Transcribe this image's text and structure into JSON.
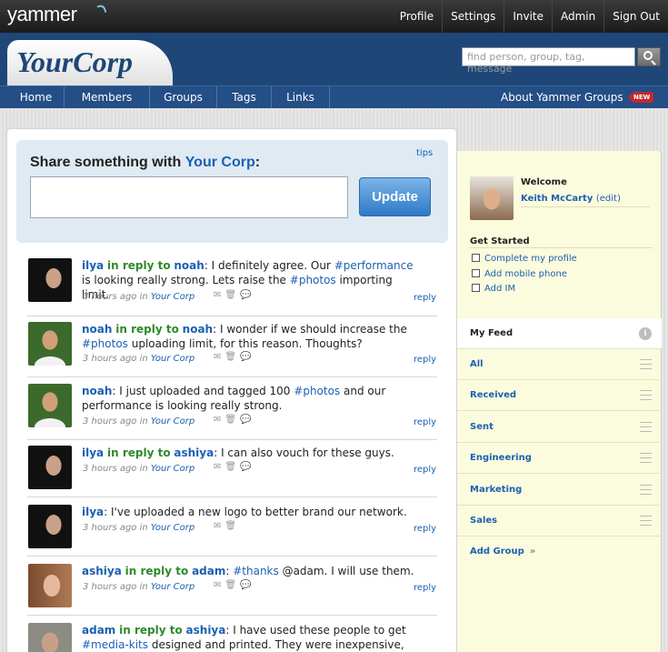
{
  "app": {
    "logo": "yammer",
    "company": "YourCorp"
  },
  "topnav": {
    "items": [
      "Profile",
      "Settings",
      "Invite",
      "Admin",
      "Sign Out"
    ]
  },
  "search": {
    "placeholder": "find person, group, tag, message",
    "icon": "search-icon"
  },
  "mainnav": {
    "items": [
      "Home",
      "Members",
      "Groups",
      "Tags",
      "Links"
    ],
    "about": "About Yammer Groups",
    "badge": "NEW"
  },
  "share": {
    "prefix": "Share something with ",
    "target": "Your Corp",
    "suffix": ":",
    "tips": "tips",
    "button": "Update",
    "value": ""
  },
  "messages": [
    {
      "user": "ilya",
      "reply_label": "in reply to",
      "reply_to": "noah",
      "parts": [
        ": I definitely agree. Our ",
        "#performance",
        " is looking really strong. Lets raise the ",
        "#photos",
        " importing limit."
      ],
      "time": "3 hours ago in",
      "group": "Your Corp",
      "reply": "reply",
      "avatar": "ilya"
    },
    {
      "user": "noah",
      "reply_label": "in reply to",
      "reply_to": "noah",
      "parts": [
        ": I wonder if we should increase the ",
        "#photos",
        " uploading limit, for this reason. Thoughts?"
      ],
      "time": "3 hours ago in",
      "group": "Your Corp",
      "reply": "reply",
      "avatar": "noah"
    },
    {
      "user": "noah",
      "parts": [
        ":  I just uploaded and tagged 100 ",
        "#photos",
        " and our performance is looking really strong."
      ],
      "time": "3 hours ago in",
      "group": "Your Corp",
      "reply": "reply",
      "avatar": "noah"
    },
    {
      "user": "ilya",
      "reply_label": "in reply to",
      "reply_to": "ashiya",
      "parts": [
        ": I can also vouch for these guys."
      ],
      "time": "3 hours ago in",
      "group": "Your Corp",
      "reply": "reply",
      "avatar": "ilya"
    },
    {
      "user": "ilya",
      "parts": [
        ": I've uploaded a new logo to better brand our network."
      ],
      "time": "3 hours ago in",
      "group": "Your Corp",
      "reply": "reply",
      "avatar": "ilya"
    },
    {
      "user": "ashiya",
      "reply_label": "in reply to",
      "reply_to": "adam",
      "parts": [
        ":  ",
        "#thanks",
        " @adam. I will use them."
      ],
      "time": "3 hours ago in",
      "group": "Your Corp",
      "reply": "reply",
      "avatar": "ashiya"
    },
    {
      "user": "adam",
      "reply_label": "in reply to",
      "reply_to": "ashiya",
      "parts": [
        ": I have used these people to get ",
        "#media-kits",
        " designed and printed. They were inexpensive, fast,"
      ],
      "time": "",
      "group": "",
      "reply": "",
      "avatar": "adam"
    }
  ],
  "sidebar": {
    "welcome": "Welcome",
    "user_name": "Keith McCarty",
    "edit": "(edit)",
    "get_started": "Get Started",
    "tasks": [
      "Complete my profile",
      "Add mobile phone",
      "Add IM"
    ],
    "my_feed": "My Feed",
    "info_icon": "i",
    "feeds": [
      "All",
      "Received",
      "Sent",
      "Engineering",
      "Marketing",
      "Sales"
    ],
    "add_group": "Add Group",
    "add_group_arrow": "»"
  }
}
